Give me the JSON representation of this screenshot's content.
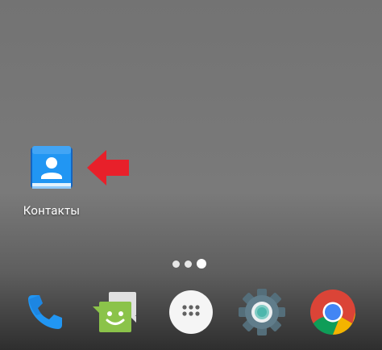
{
  "home": {
    "apps": [
      {
        "label": "Контакты",
        "icon": "contacts-icon"
      }
    ],
    "page_indicator": {
      "count": 3,
      "current": 3
    },
    "dock": [
      {
        "name": "phone",
        "icon": "phone-icon"
      },
      {
        "name": "messages",
        "icon": "messages-icon"
      },
      {
        "name": "app-drawer",
        "icon": "apps-icon"
      },
      {
        "name": "settings",
        "icon": "settings-icon"
      },
      {
        "name": "chrome",
        "icon": "chrome-icon"
      }
    ]
  },
  "annotation": {
    "icon": "red-arrow-icon",
    "color": "#e8202a"
  },
  "colors": {
    "contacts_blue": "#1e88e5",
    "phone_blue": "#2196f3",
    "messages_green": "#8bc34a",
    "settings_teal": "#607d8b"
  }
}
